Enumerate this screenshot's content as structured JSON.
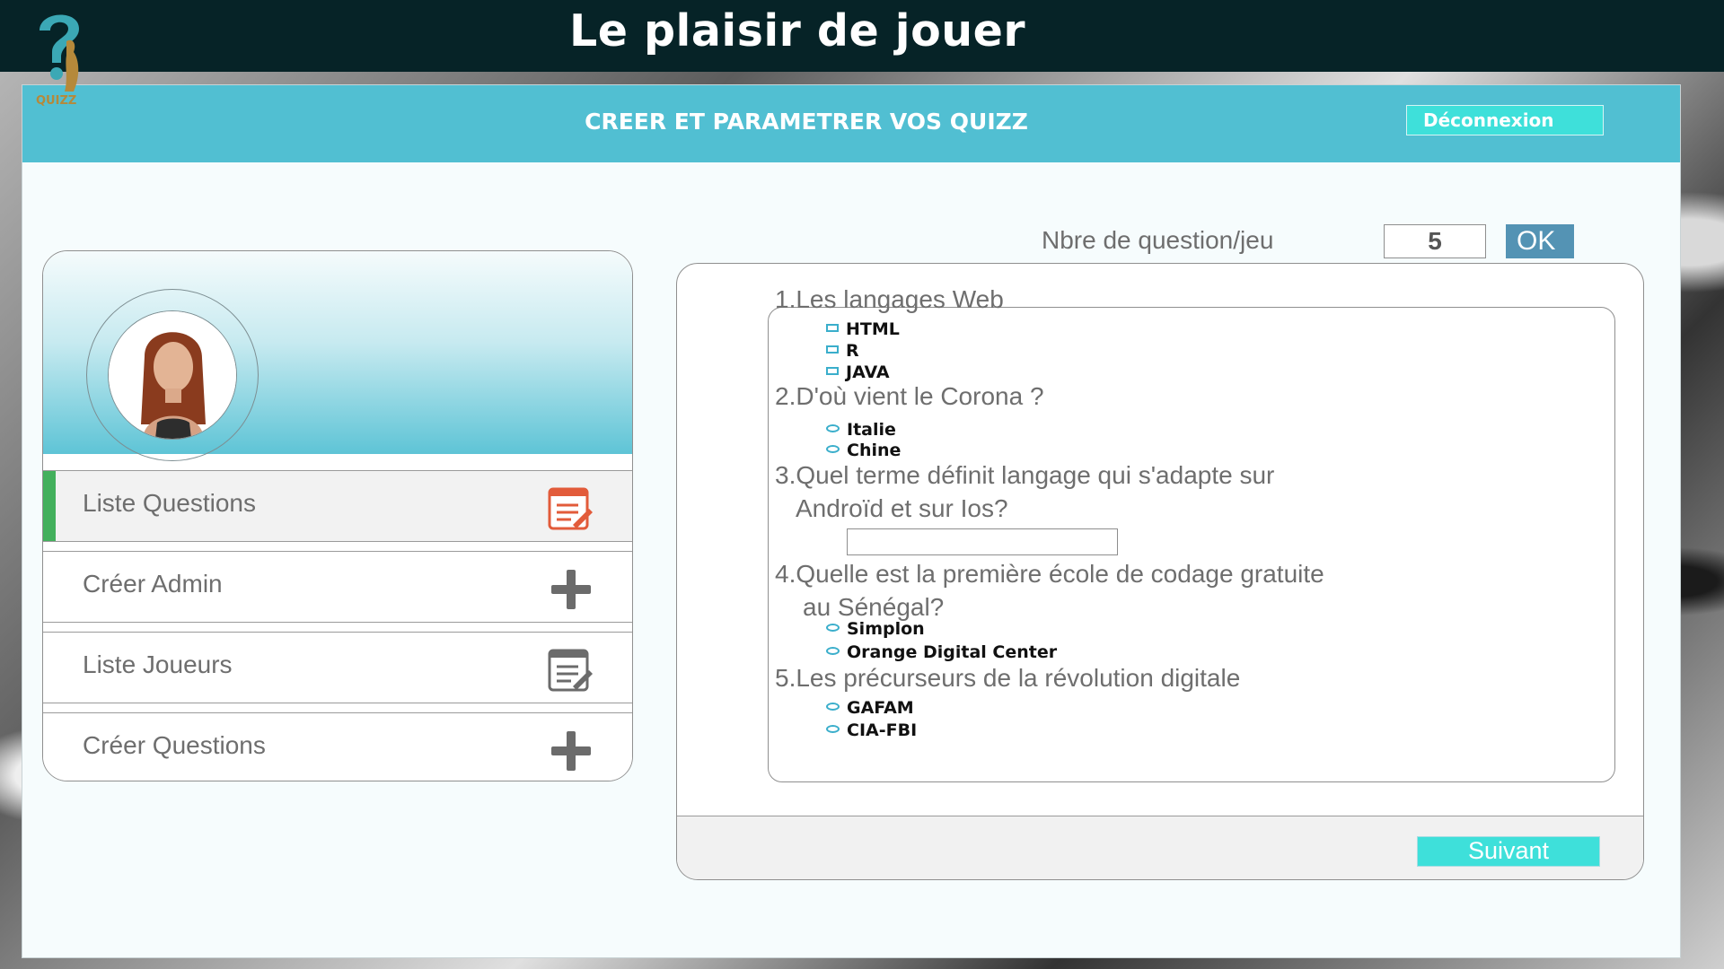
{
  "app": {
    "title": "Le plaisir  de jouer"
  },
  "header": {
    "title": "CREER ET PARAMETRER VOS QUIZZ",
    "logout_label": "Déconnexion"
  },
  "sidebar": {
    "items": [
      {
        "label": "Liste Questions",
        "icon": "edit-list-icon",
        "active": true
      },
      {
        "label": "Créer Admin",
        "icon": "plus-icon",
        "active": false
      },
      {
        "label": "Liste Joueurs",
        "icon": "edit-list-icon",
        "active": false
      },
      {
        "label": "Créer Questions",
        "icon": "plus-icon",
        "active": false
      }
    ]
  },
  "settings": {
    "count_label": "Nbre de question/jeu",
    "count_value": "5",
    "ok_label": "OK"
  },
  "questions": [
    {
      "line1": "1.Les langages Web",
      "line2": "",
      "type": "checkbox",
      "options": [
        "HTML",
        "R",
        "JAVA"
      ]
    },
    {
      "line1": "2.D'où vient le Corona ?",
      "line2": "",
      "type": "radio",
      "options": [
        "Italie",
        "Chine"
      ]
    },
    {
      "line1": "3.Quel terme définit langage qui s'adapte sur",
      "line2": "Androïd et sur Ios?",
      "type": "text",
      "options": []
    },
    {
      "line1": "4.Quelle est la première école de codage gratuite",
      "line2": "au Sénégal?",
      "type": "radio",
      "options": [
        "Simplon",
        "Orange Digital Center"
      ]
    },
    {
      "line1": "5.Les précurseurs de la révolution digitale",
      "line2": "",
      "type": "radio",
      "options": [
        "GAFAM",
        "CIA-FBI"
      ]
    }
  ],
  "footer": {
    "next_label": "Suivant"
  },
  "colors": {
    "topbar": "#062327",
    "header": "#51bfd2",
    "button": "#3ee0da",
    "ok": "#5493b4",
    "active_accent": "#43b05c"
  }
}
